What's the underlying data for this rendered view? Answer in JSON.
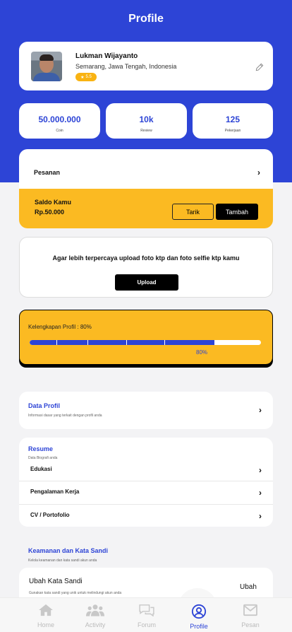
{
  "header": {
    "title": "Profile"
  },
  "user": {
    "name": "Lukman Wijayanto",
    "location": "Semarang, Jawa Tengah, Indonesia",
    "rating": "5.5"
  },
  "stats": [
    {
      "value": "50.000.000",
      "label": "Coin"
    },
    {
      "value": "10k",
      "label": "Review"
    },
    {
      "value": "125",
      "label": "Pekerjaan"
    }
  ],
  "pesanan": {
    "label": "Pesanan"
  },
  "saldo": {
    "title": "Saldo Kamu",
    "value": "Rp.50.000",
    "tarik_label": "Tarik",
    "tambah_label": "Tambah"
  },
  "verify": {
    "text": "Agar lebih terpercaya upload foto ktp dan foto selfie ktp kamu",
    "upload_label": "Upload"
  },
  "profile_completion": {
    "label": "Kelengkapan Profil : 80%",
    "percent_text": "80%",
    "value": 0.8
  },
  "data_profil": {
    "title": "Data Profil",
    "subtitle": "Informasi dasar yang terkait dengan profil anda"
  },
  "resume": {
    "title": "Resume",
    "subtitle": "Data Biografi anda",
    "items": [
      {
        "label": "Edukasi"
      },
      {
        "label": "Pengalaman Kerja"
      },
      {
        "label": "CV / Portofolio"
      }
    ]
  },
  "security": {
    "title": "Keamanan dan Kata Sandi",
    "subtitle": "Kelola keamanan dan kata sandi akun anda",
    "change_title": "Ubah Kata Sandi",
    "change_subtitle": "Gunakan kata sandi yang unik untuk melindungi akun anda",
    "change_action": "Ubah"
  },
  "tabbar": {
    "items": [
      {
        "label": "Home",
        "icon": "home-icon"
      },
      {
        "label": "Activity",
        "icon": "users-icon"
      },
      {
        "label": "Forum",
        "icon": "chat-icon"
      },
      {
        "label": "Profile",
        "icon": "user-circle-icon"
      },
      {
        "label": "Pesan",
        "icon": "mail-icon"
      }
    ],
    "active": "Profile"
  },
  "colors": {
    "primary": "#2d44d6",
    "accent": "#fbba22",
    "background": "#f3f3f5"
  }
}
